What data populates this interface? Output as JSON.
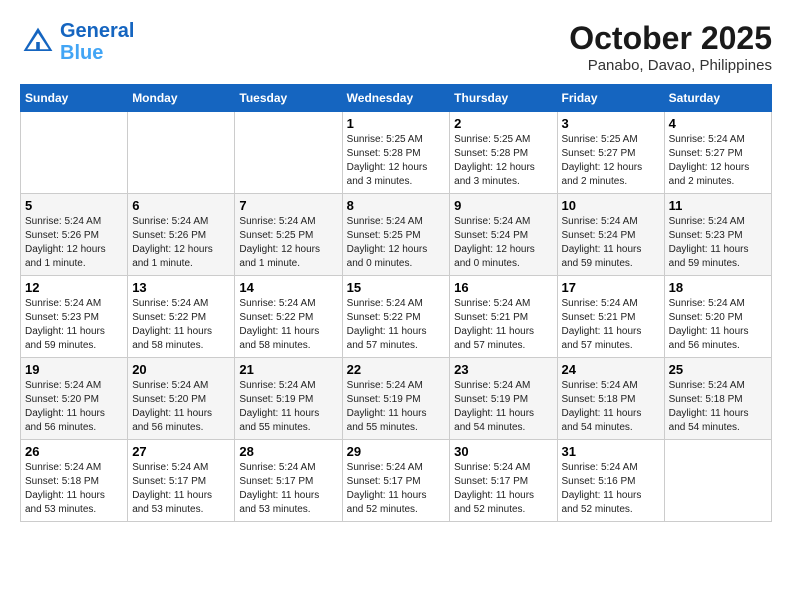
{
  "header": {
    "logo_line1": "General",
    "logo_line2": "Blue",
    "month": "October 2025",
    "location": "Panabo, Davao, Philippines"
  },
  "weekdays": [
    "Sunday",
    "Monday",
    "Tuesday",
    "Wednesday",
    "Thursday",
    "Friday",
    "Saturday"
  ],
  "weeks": [
    [
      {
        "day": "",
        "info": ""
      },
      {
        "day": "",
        "info": ""
      },
      {
        "day": "",
        "info": ""
      },
      {
        "day": "1",
        "info": "Sunrise: 5:25 AM\nSunset: 5:28 PM\nDaylight: 12 hours and 3 minutes."
      },
      {
        "day": "2",
        "info": "Sunrise: 5:25 AM\nSunset: 5:28 PM\nDaylight: 12 hours and 3 minutes."
      },
      {
        "day": "3",
        "info": "Sunrise: 5:25 AM\nSunset: 5:27 PM\nDaylight: 12 hours and 2 minutes."
      },
      {
        "day": "4",
        "info": "Sunrise: 5:24 AM\nSunset: 5:27 PM\nDaylight: 12 hours and 2 minutes."
      }
    ],
    [
      {
        "day": "5",
        "info": "Sunrise: 5:24 AM\nSunset: 5:26 PM\nDaylight: 12 hours and 1 minute."
      },
      {
        "day": "6",
        "info": "Sunrise: 5:24 AM\nSunset: 5:26 PM\nDaylight: 12 hours and 1 minute."
      },
      {
        "day": "7",
        "info": "Sunrise: 5:24 AM\nSunset: 5:25 PM\nDaylight: 12 hours and 1 minute."
      },
      {
        "day": "8",
        "info": "Sunrise: 5:24 AM\nSunset: 5:25 PM\nDaylight: 12 hours and 0 minutes."
      },
      {
        "day": "9",
        "info": "Sunrise: 5:24 AM\nSunset: 5:24 PM\nDaylight: 12 hours and 0 minutes."
      },
      {
        "day": "10",
        "info": "Sunrise: 5:24 AM\nSunset: 5:24 PM\nDaylight: 11 hours and 59 minutes."
      },
      {
        "day": "11",
        "info": "Sunrise: 5:24 AM\nSunset: 5:23 PM\nDaylight: 11 hours and 59 minutes."
      }
    ],
    [
      {
        "day": "12",
        "info": "Sunrise: 5:24 AM\nSunset: 5:23 PM\nDaylight: 11 hours and 59 minutes."
      },
      {
        "day": "13",
        "info": "Sunrise: 5:24 AM\nSunset: 5:22 PM\nDaylight: 11 hours and 58 minutes."
      },
      {
        "day": "14",
        "info": "Sunrise: 5:24 AM\nSunset: 5:22 PM\nDaylight: 11 hours and 58 minutes."
      },
      {
        "day": "15",
        "info": "Sunrise: 5:24 AM\nSunset: 5:22 PM\nDaylight: 11 hours and 57 minutes."
      },
      {
        "day": "16",
        "info": "Sunrise: 5:24 AM\nSunset: 5:21 PM\nDaylight: 11 hours and 57 minutes."
      },
      {
        "day": "17",
        "info": "Sunrise: 5:24 AM\nSunset: 5:21 PM\nDaylight: 11 hours and 57 minutes."
      },
      {
        "day": "18",
        "info": "Sunrise: 5:24 AM\nSunset: 5:20 PM\nDaylight: 11 hours and 56 minutes."
      }
    ],
    [
      {
        "day": "19",
        "info": "Sunrise: 5:24 AM\nSunset: 5:20 PM\nDaylight: 11 hours and 56 minutes."
      },
      {
        "day": "20",
        "info": "Sunrise: 5:24 AM\nSunset: 5:20 PM\nDaylight: 11 hours and 56 minutes."
      },
      {
        "day": "21",
        "info": "Sunrise: 5:24 AM\nSunset: 5:19 PM\nDaylight: 11 hours and 55 minutes."
      },
      {
        "day": "22",
        "info": "Sunrise: 5:24 AM\nSunset: 5:19 PM\nDaylight: 11 hours and 55 minutes."
      },
      {
        "day": "23",
        "info": "Sunrise: 5:24 AM\nSunset: 5:19 PM\nDaylight: 11 hours and 54 minutes."
      },
      {
        "day": "24",
        "info": "Sunrise: 5:24 AM\nSunset: 5:18 PM\nDaylight: 11 hours and 54 minutes."
      },
      {
        "day": "25",
        "info": "Sunrise: 5:24 AM\nSunset: 5:18 PM\nDaylight: 11 hours and 54 minutes."
      }
    ],
    [
      {
        "day": "26",
        "info": "Sunrise: 5:24 AM\nSunset: 5:18 PM\nDaylight: 11 hours and 53 minutes."
      },
      {
        "day": "27",
        "info": "Sunrise: 5:24 AM\nSunset: 5:17 PM\nDaylight: 11 hours and 53 minutes."
      },
      {
        "day": "28",
        "info": "Sunrise: 5:24 AM\nSunset: 5:17 PM\nDaylight: 11 hours and 53 minutes."
      },
      {
        "day": "29",
        "info": "Sunrise: 5:24 AM\nSunset: 5:17 PM\nDaylight: 11 hours and 52 minutes."
      },
      {
        "day": "30",
        "info": "Sunrise: 5:24 AM\nSunset: 5:17 PM\nDaylight: 11 hours and 52 minutes."
      },
      {
        "day": "31",
        "info": "Sunrise: 5:24 AM\nSunset: 5:16 PM\nDaylight: 11 hours and 52 minutes."
      },
      {
        "day": "",
        "info": ""
      }
    ]
  ]
}
